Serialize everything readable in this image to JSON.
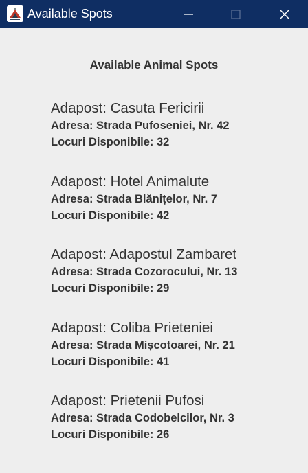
{
  "window": {
    "title": "Available Spots"
  },
  "heading": "Available Animal Spots",
  "shelters": [
    {
      "name": "Adapost: Casuta Fericirii",
      "address": "Adresa: Strada Pufoseniei, Nr. 42",
      "spots": "Locuri Disponibile: 32"
    },
    {
      "name": "Adapost: Hotel Animalute",
      "address": "Adresa: Strada Blănițelor, Nr. 7",
      "spots": "Locuri Disponibile: 42"
    },
    {
      "name": "Adapost: Adapostul Zambaret",
      "address": "Adresa: Strada Cozorocului, Nr. 13",
      "spots": "Locuri Disponibile: 29"
    },
    {
      "name": "Adapost: Coliba Prieteniei",
      "address": "Adresa: Strada Mișcotoarei, Nr. 21",
      "spots": "Locuri Disponibile: 41"
    },
    {
      "name": "Adapost: Prietenii Pufosi",
      "address": "Adresa: Strada Codobelcilor, Nr. 3",
      "spots": "Locuri Disponibile: 26"
    }
  ],
  "colors": {
    "titlebar": "#0f2e63",
    "background": "#eeeeee",
    "text": "#333333"
  }
}
